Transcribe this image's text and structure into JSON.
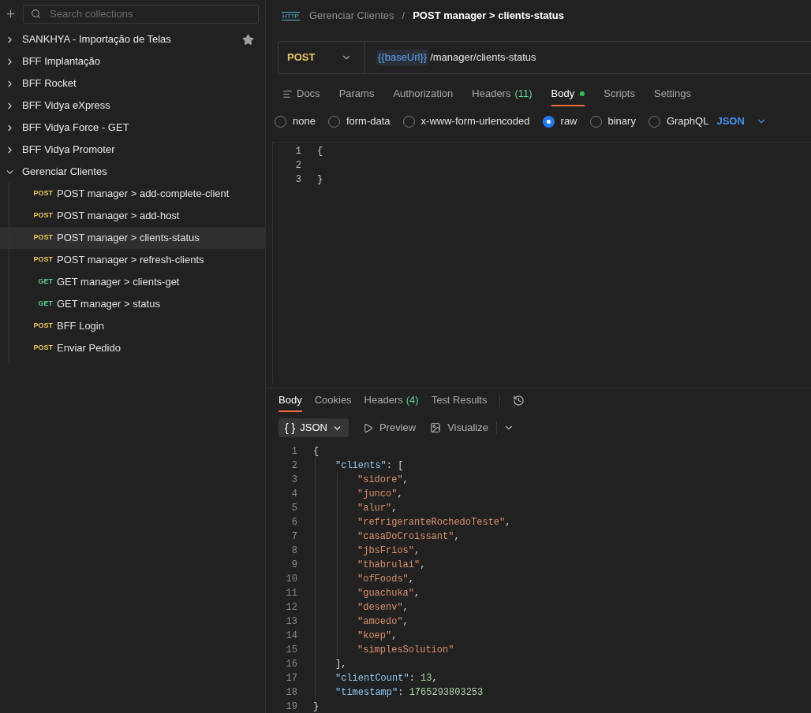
{
  "sidebar": {
    "search": {
      "placeholder": "Search collections"
    },
    "collections": [
      {
        "name": "SANKHYA - Importação de Telas",
        "expanded": false,
        "starred": true
      },
      {
        "name": "BFF Implantação",
        "expanded": false,
        "starred": false
      },
      {
        "name": "BFF Rocket",
        "expanded": false,
        "starred": false
      },
      {
        "name": "BFF Vidya eXpress",
        "expanded": false,
        "starred": false
      },
      {
        "name": "BFF Vidya Force - GET",
        "expanded": false,
        "starred": false
      },
      {
        "name": "BFF Vidya Promoter",
        "expanded": false,
        "starred": false
      },
      {
        "name": "Gerenciar Clientes",
        "expanded": true,
        "starred": false,
        "children": [
          {
            "method": "POST",
            "name": "POST manager > add-complete-client",
            "selected": false
          },
          {
            "method": "POST",
            "name": "POST manager > add-host",
            "selected": false
          },
          {
            "method": "POST",
            "name": "POST manager > clients-status",
            "selected": true
          },
          {
            "method": "POST",
            "name": "POST manager > refresh-clients",
            "selected": false
          },
          {
            "method": "GET",
            "name": "GET manager > clients-get",
            "selected": false
          },
          {
            "method": "GET",
            "name": "GET manager > status",
            "selected": false
          },
          {
            "method": "POST",
            "name": "BFF Login",
            "selected": false
          },
          {
            "method": "POST",
            "name": "Enviar Pedido",
            "selected": false
          }
        ]
      }
    ]
  },
  "request": {
    "breadcrumb": {
      "badge": "HTTP",
      "parent": "Gerenciar Clientes",
      "separator": "/",
      "title": "POST manager > clients-status"
    },
    "method": "POST",
    "url_variable": "{{baseUrl}}",
    "url_path": "/manager/clients-status",
    "tabs": [
      {
        "kind": "docs",
        "label": "Docs",
        "selected": false
      },
      {
        "kind": "plain",
        "label": "Params",
        "selected": false
      },
      {
        "kind": "plain",
        "label": "Authorization",
        "selected": false
      },
      {
        "kind": "plain",
        "label": "Headers",
        "count": "(11)",
        "selected": false
      },
      {
        "kind": "plain",
        "label": "Body",
        "modified": true,
        "selected": true
      },
      {
        "kind": "plain",
        "label": "Scripts",
        "selected": false
      },
      {
        "kind": "plain",
        "label": "Settings",
        "selected": false
      }
    ],
    "body_modes": [
      {
        "label": "none",
        "selected": false
      },
      {
        "label": "form-data",
        "selected": false
      },
      {
        "label": "x-www-form-urlencoded",
        "selected": false
      },
      {
        "label": "raw",
        "selected": true
      },
      {
        "label": "binary",
        "selected": false
      },
      {
        "label": "GraphQL",
        "selected": false
      }
    ],
    "raw_format": "JSON",
    "editor_lines": [
      {
        "number": "1",
        "tokens": [
          {
            "kind": "punct",
            "text": "{"
          }
        ]
      },
      {
        "number": "2"
      },
      {
        "number": "3",
        "tokens": [
          {
            "kind": "punct",
            "text": "}"
          }
        ]
      }
    ]
  },
  "response": {
    "tabs": [
      {
        "label": "Body",
        "selected": true
      },
      {
        "label": "Cookies",
        "selected": false
      },
      {
        "label": "Headers",
        "count": "(4)",
        "selected": false
      },
      {
        "label": "Test Results",
        "selected": false
      }
    ],
    "format": {
      "glyph": "{ }",
      "label": "JSON"
    },
    "preview": "Preview",
    "visualize": "Visualize",
    "code": {
      "number": "1",
      "tokens": [
        {
          "kind": "punct",
          "text": "{"
        }
      ],
      "children": [
        {
          "number": "2",
          "tokens": [
            {
              "kind": "key",
              "text": "\"clients\""
            },
            {
              "kind": "punct",
              "text": ": ["
            }
          ],
          "children": [
            {
              "number": "3",
              "tokens": [
                {
                  "kind": "string",
                  "text": "\"sidore\""
                },
                {
                  "kind": "punct",
                  "text": ","
                }
              ]
            },
            {
              "number": "4",
              "tokens": [
                {
                  "kind": "string",
                  "text": "\"junco\""
                },
                {
                  "kind": "punct",
                  "text": ","
                }
              ]
            },
            {
              "number": "5",
              "tokens": [
                {
                  "kind": "string",
                  "text": "\"alur\""
                },
                {
                  "kind": "punct",
                  "text": ","
                }
              ]
            },
            {
              "number": "6",
              "tokens": [
                {
                  "kind": "string",
                  "text": "\"refrigeranteRochedoTeste\""
                },
                {
                  "kind": "punct",
                  "text": ","
                }
              ]
            },
            {
              "number": "7",
              "tokens": [
                {
                  "kind": "string",
                  "text": "\"casaDoCroissant\""
                },
                {
                  "kind": "punct",
                  "text": ","
                }
              ]
            },
            {
              "number": "8",
              "tokens": [
                {
                  "kind": "string",
                  "text": "\"jbsFrios\""
                },
                {
                  "kind": "punct",
                  "text": ","
                }
              ]
            },
            {
              "number": "9",
              "tokens": [
                {
                  "kind": "string",
                  "text": "\"thabrulai\""
                },
                {
                  "kind": "punct",
                  "text": ","
                }
              ]
            },
            {
              "number": "10",
              "tokens": [
                {
                  "kind": "string",
                  "text": "\"ofFoods\""
                },
                {
                  "kind": "punct",
                  "text": ","
                }
              ]
            },
            {
              "number": "11",
              "tokens": [
                {
                  "kind": "string",
                  "text": "\"guachuka\""
                },
                {
                  "kind": "punct",
                  "text": ","
                }
              ]
            },
            {
              "number": "12",
              "tokens": [
                {
                  "kind": "string",
                  "text": "\"desenv\""
                },
                {
                  "kind": "punct",
                  "text": ","
                }
              ]
            },
            {
              "number": "13",
              "tokens": [
                {
                  "kind": "string",
                  "text": "\"amoedo\""
                },
                {
                  "kind": "punct",
                  "text": ","
                }
              ]
            },
            {
              "number": "14",
              "tokens": [
                {
                  "kind": "string",
                  "text": "\"koep\""
                },
                {
                  "kind": "punct",
                  "text": ","
                }
              ]
            },
            {
              "number": "15",
              "tokens": [
                {
                  "kind": "string",
                  "text": "\"simplesSolution\""
                }
              ]
            }
          ],
          "close": {
            "number": "16",
            "tokens": [
              {
                "kind": "punct",
                "text": "],"
              }
            ]
          }
        },
        {
          "number": "17",
          "tokens": [
            {
              "kind": "key",
              "text": "\"clientCount\""
            },
            {
              "kind": "punct",
              "text": ": "
            },
            {
              "kind": "number",
              "text": "13"
            },
            {
              "kind": "punct",
              "text": ","
            }
          ]
        },
        {
          "number": "18",
          "tokens": [
            {
              "kind": "key",
              "text": "\"timestamp\""
            },
            {
              "kind": "punct",
              "text": ": "
            },
            {
              "kind": "number",
              "text": "1765293803253"
            }
          ]
        }
      ],
      "close": {
        "number": "19",
        "tokens": [
          {
            "kind": "punct",
            "text": "}"
          }
        ]
      }
    }
  }
}
